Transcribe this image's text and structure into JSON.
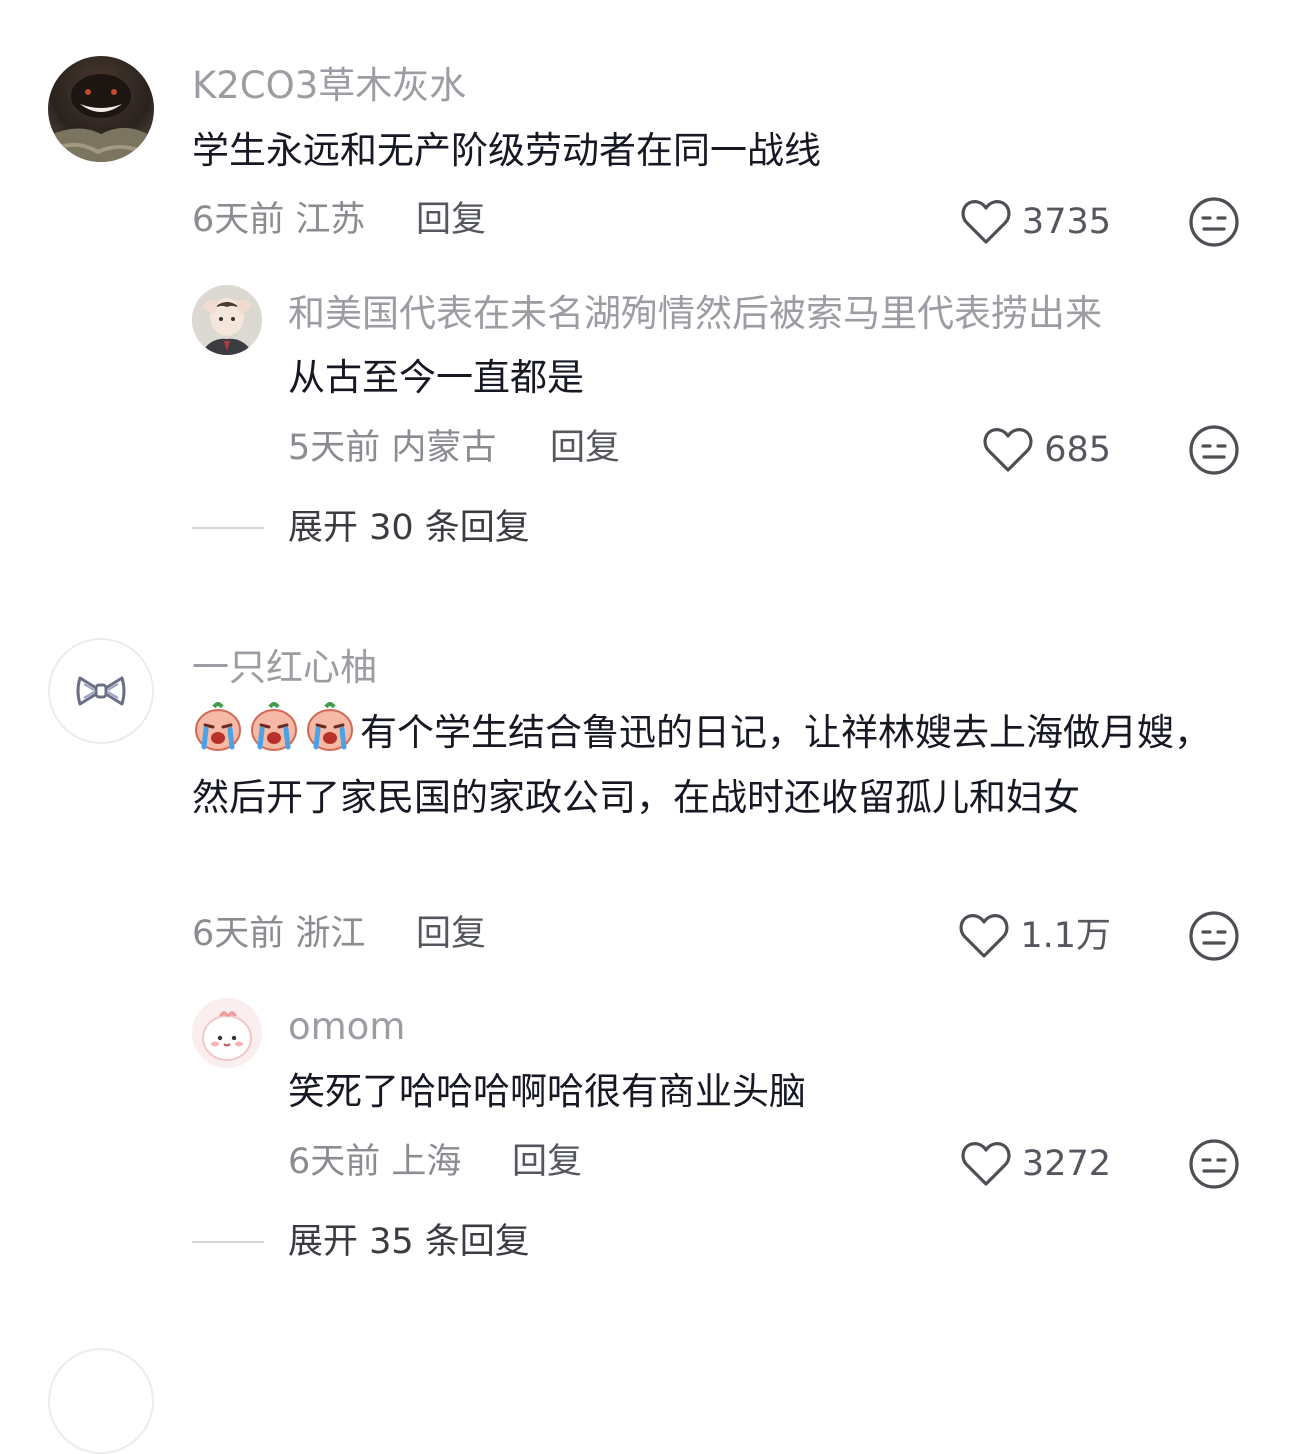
{
  "comments": [
    {
      "username": "K2CO3草木灰水",
      "text": "学生永远和无产阶级劳动者在同一战线",
      "time": "6天前",
      "location": "江苏",
      "reply_label": "回复",
      "likes": "3735",
      "replies": [
        {
          "username": "和美国代表在未名湖殉情然后被索马里代表捞出来",
          "text": "从古至今一直都是",
          "time": "5天前",
          "location": "内蒙古",
          "reply_label": "回复",
          "likes": "685"
        }
      ],
      "expand_label": "展开 30 条回复"
    },
    {
      "username": "一只红心柚",
      "text": "有个学生结合鲁迅的日记，让祥林嫂去上海做月嫂，然后开了家民国的家政公司，在战时还收留孤儿和妇女",
      "time": "6天前",
      "location": "浙江",
      "reply_label": "回复",
      "likes": "1.1万",
      "replies": [
        {
          "username": "omom",
          "text": "笑死了哈哈哈啊哈很有商业头脑",
          "time": "6天前",
          "location": "上海",
          "reply_label": "回复",
          "likes": "3272"
        }
      ],
      "expand_label": "展开 35 条回复"
    }
  ],
  "icons": {
    "like": "heart-outline-icon",
    "dislike": "neutral-face-icon"
  },
  "colors": {
    "text": "#161823",
    "username": "#9b9da3",
    "meta": "#8a8c92"
  }
}
